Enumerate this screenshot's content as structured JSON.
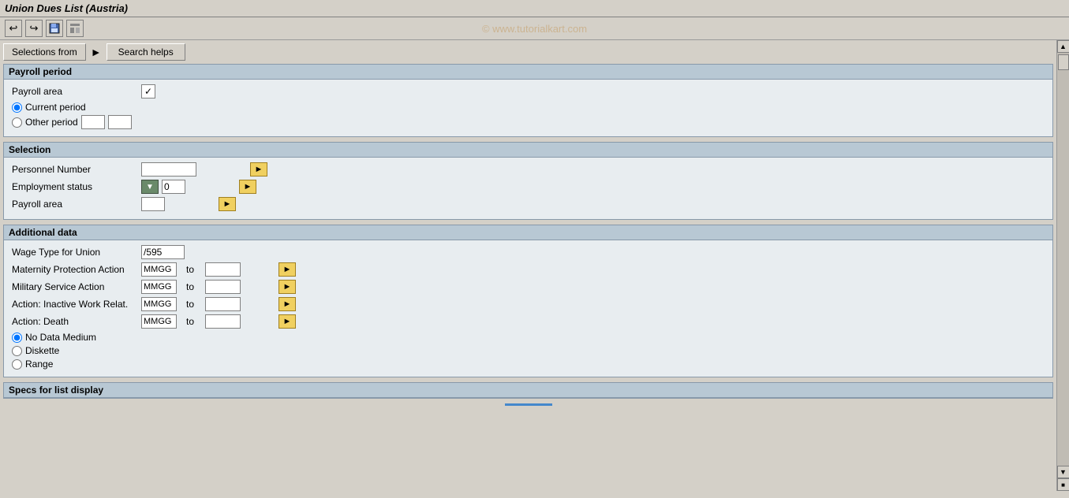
{
  "title": "Union Dues List (Austria)",
  "watermark": "© www.tutorialkart.com",
  "toolbar": {
    "icons": [
      "back-icon",
      "forward-icon",
      "save-icon",
      "layout-icon"
    ]
  },
  "buttons": {
    "selections_from": "Selections from",
    "search_helps": "Search helps"
  },
  "payroll_period": {
    "header": "Payroll period",
    "payroll_area_label": "Payroll area",
    "current_period_label": "Current period",
    "other_period_label": "Other period"
  },
  "selection": {
    "header": "Selection",
    "personnel_number_label": "Personnel Number",
    "employment_status_label": "Employment status",
    "employment_status_value": "0",
    "payroll_area_label": "Payroll area"
  },
  "additional_data": {
    "header": "Additional data",
    "wage_type_label": "Wage Type for Union",
    "wage_type_value": "/595",
    "maternity_label": "Maternity Protection Action",
    "maternity_from": "MMGG",
    "maternity_to": "",
    "military_label": "Military Service Action",
    "military_from": "MMGG",
    "military_to": "",
    "inactive_label": "Action: Inactive Work Relat.",
    "inactive_from": "MMGG",
    "inactive_to": "",
    "death_label": "Action: Death",
    "death_from": "MMGG",
    "death_to": "",
    "to_label": "to",
    "no_data_medium_label": "No Data Medium",
    "diskette_label": "Diskette",
    "range_label": "Range"
  },
  "bottom": {
    "specs_label": "Specs for list display"
  }
}
